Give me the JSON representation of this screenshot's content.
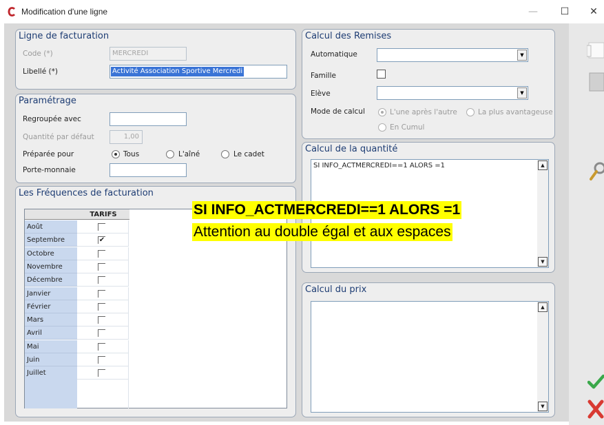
{
  "window": {
    "title": "Modification d'une ligne",
    "minimize_glyph": "—",
    "maximize_glyph": "☐",
    "close_glyph": "✕"
  },
  "ligne": {
    "title": "Ligne de facturation",
    "code_label": "Code (*)",
    "code_value": "MERCREDI",
    "libelle_label": "Libellé (*)",
    "libelle_value": "Activité Association Sportive Mercredi"
  },
  "parametrage": {
    "title": "Paramétrage",
    "regroupee_label": "Regroupée avec",
    "regroupee_value": "",
    "quantite_label": "Quantité par défaut",
    "quantite_value": "1,00",
    "preparee_label": "Préparée pour",
    "options": [
      "Tous",
      "L'aîné",
      "Le cadet"
    ],
    "selected_option": "Tous",
    "porte_monnaie_label": "Porte-monnaie",
    "porte_monnaie_value": ""
  },
  "frequences": {
    "title": "Les Fréquences de facturation",
    "column_header": "TARIFS",
    "months": [
      {
        "name": "Août",
        "checked": false
      },
      {
        "name": "Septembre",
        "checked": true
      },
      {
        "name": "Octobre",
        "checked": false
      },
      {
        "name": "Novembre",
        "checked": false
      },
      {
        "name": "Décembre",
        "checked": false
      },
      {
        "name": "Janvier",
        "checked": false
      },
      {
        "name": "Février",
        "checked": false
      },
      {
        "name": "Mars",
        "checked": false
      },
      {
        "name": "Avril",
        "checked": false
      },
      {
        "name": "Mai",
        "checked": false
      },
      {
        "name": "Juin",
        "checked": false
      },
      {
        "name": "Juillet",
        "checked": false
      }
    ]
  },
  "remises": {
    "title": "Calcul des Remises",
    "automatique_label": "Automatique",
    "automatique_value": "",
    "famille_label": "Famille",
    "famille_checked": false,
    "eleve_label": "Elève",
    "eleve_value": "",
    "mode_label": "Mode de calcul",
    "mode_options": [
      "L'une après l'autre",
      "La plus avantageuse",
      "En Cumul"
    ],
    "mode_selected": "L'une après l'autre"
  },
  "quantite": {
    "title": "Calcul de la quantité",
    "formula": "SI INFO_ACTMERCREDI==1 ALORS =1"
  },
  "prix": {
    "title": "Calcul du prix",
    "formula": ""
  },
  "annotation": {
    "line1": "SI INFO_ACTMERCREDI==1 ALORS =1",
    "line2": "Attention au double égal et aux espaces"
  },
  "colors": {
    "panel_title": "#1d3c73",
    "month_cell": "#c9d8ee",
    "annotation": "#ffff00",
    "selection": "#3a74d6"
  },
  "icons": [
    "app-logo-icon",
    "copy-icon",
    "magnifier-icon",
    "validate-check-icon",
    "cancel-cross-icon"
  ]
}
